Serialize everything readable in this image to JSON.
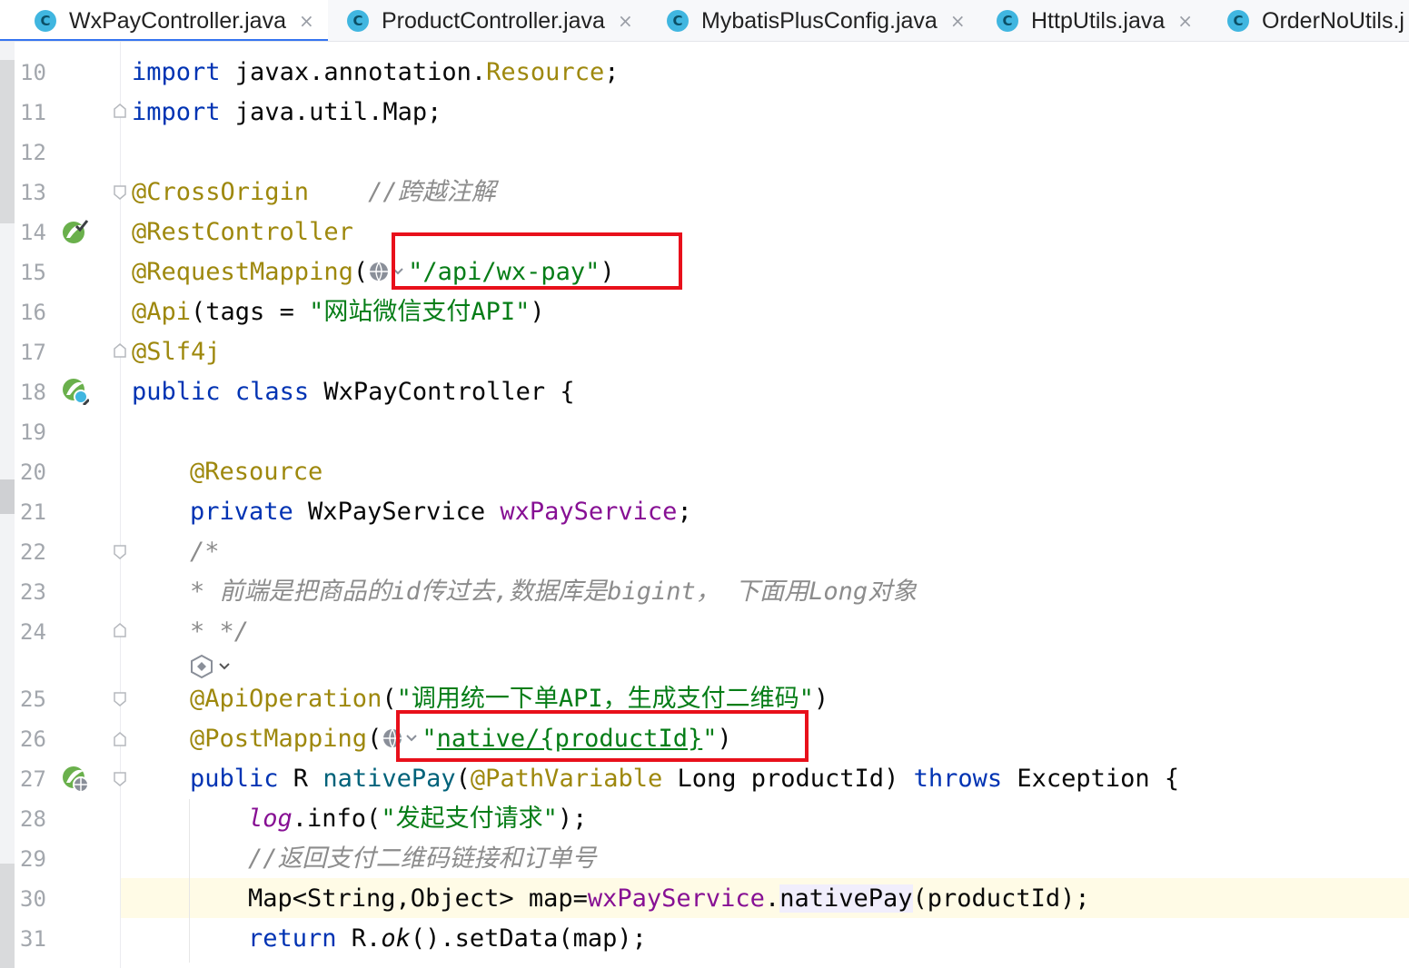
{
  "tabs": [
    {
      "icon": "C",
      "label": "WxPayController.java",
      "active": true,
      "closable": true
    },
    {
      "icon": "C",
      "label": "ProductController.java",
      "active": false,
      "closable": true
    },
    {
      "icon": "C",
      "label": "MybatisPlusConfig.java",
      "active": false,
      "closable": true
    },
    {
      "icon": "C",
      "label": "HttpUtils.java",
      "active": false,
      "closable": true
    },
    {
      "icon": "C",
      "label": "OrderNoUtils.j",
      "active": false,
      "closable": false
    }
  ],
  "close_glyph": "×",
  "line_numbers": [
    "10",
    "11",
    "12",
    "13",
    "14",
    "15",
    "16",
    "17",
    "18",
    "19",
    "20",
    "21",
    "22",
    "23",
    "24",
    "25",
    "26",
    "27",
    "28",
    "29",
    "30",
    "31"
  ],
  "code": {
    "l10": [
      "import",
      " javax.annotation.",
      "Resource",
      ";"
    ],
    "l11": [
      "import",
      " java.util.Map;"
    ],
    "l13": [
      "@CrossOrigin",
      "    ",
      "//跨越注解"
    ],
    "l14": [
      "@RestController"
    ],
    "l15": [
      "@RequestMapping",
      "(",
      "\"/api/wx-pay\"",
      ")"
    ],
    "l16": [
      "@Api",
      "(tags = ",
      "\"网站微信支付API\"",
      ")"
    ],
    "l17": [
      "@Slf4j"
    ],
    "l18": [
      "public",
      " ",
      "class",
      " WxPayController {"
    ],
    "l20": [
      "@Resource"
    ],
    "l21": [
      "private",
      " WxPayService ",
      "wxPayService",
      ";"
    ],
    "l22": [
      "/*"
    ],
    "l23": [
      "* 前端是把商品的id传过去,数据库是bigint， 下面用Long对象"
    ],
    "l24": [
      "* */"
    ],
    "l25": [
      "@ApiOperation",
      "(",
      "\"调用统一下单API，生成支付二维码\"",
      ")"
    ],
    "l26": [
      "@PostMapping",
      "(",
      "\"",
      "native/{productId}",
      "\"",
      ")"
    ],
    "l27": [
      "public",
      " R ",
      "nativePay",
      "(",
      "@PathVariable",
      " Long productId) ",
      "throws",
      " Exception {"
    ],
    "l28": [
      "log",
      ".info(",
      "\"发起支付请求\"",
      ");"
    ],
    "l29": [
      "//返回支付二维码链接和订单号"
    ],
    "l30": [
      "Map<String,Object> map=",
      "wxPayService",
      ".",
      "nativePay",
      "(productId);"
    ],
    "l31": [
      "return",
      " R.",
      "ok",
      "().setData(map);"
    ]
  },
  "gutter_icons": {
    "line14": "spring-bean-check-icon",
    "line18": "spring-bean-navigate-icon",
    "line27": "spring-web-endpoint-icon",
    "inlay": "ai-assistant-icon",
    "url_inlay": "globe-icon"
  },
  "colors": {
    "keyword": "#0033b3",
    "annotation": "#9e880d",
    "string": "#067d17",
    "comment": "#8c8c8c",
    "field": "#871094",
    "method": "#00627a",
    "highlight_box": "#e8101b",
    "tab_accent": "#3574f0"
  }
}
